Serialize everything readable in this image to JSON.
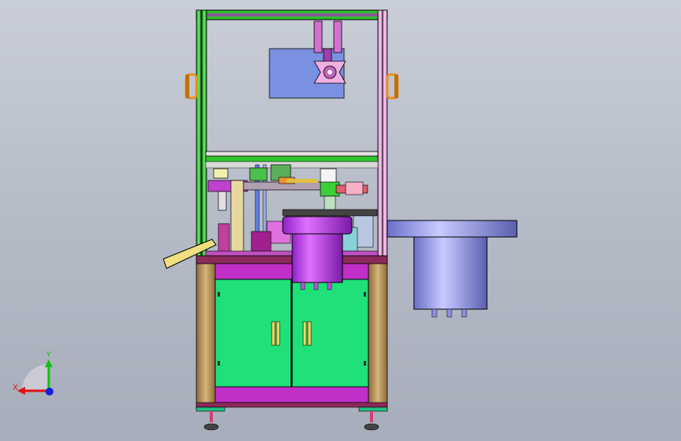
{
  "viewport": {
    "background_top": "#c9ced8",
    "background_bottom": "#a7adba"
  },
  "triad": {
    "x_label": "X",
    "y_label": "Y",
    "x_color": "#e01010",
    "y_color": "#10c010",
    "z_color": "#1020e0"
  },
  "colors": {
    "frame_green": "#2ec82e",
    "frame_pink": "#e8a0d8",
    "cabinet_green": "#1ee07a",
    "cabinet_magenta": "#c028c8",
    "bowl_purple": "#c040f0",
    "feeder_blue": "#8a8fe0",
    "handle_orange": "#e89020",
    "panel_blue": "#7890e0",
    "leg_wood": "#b8905a"
  }
}
